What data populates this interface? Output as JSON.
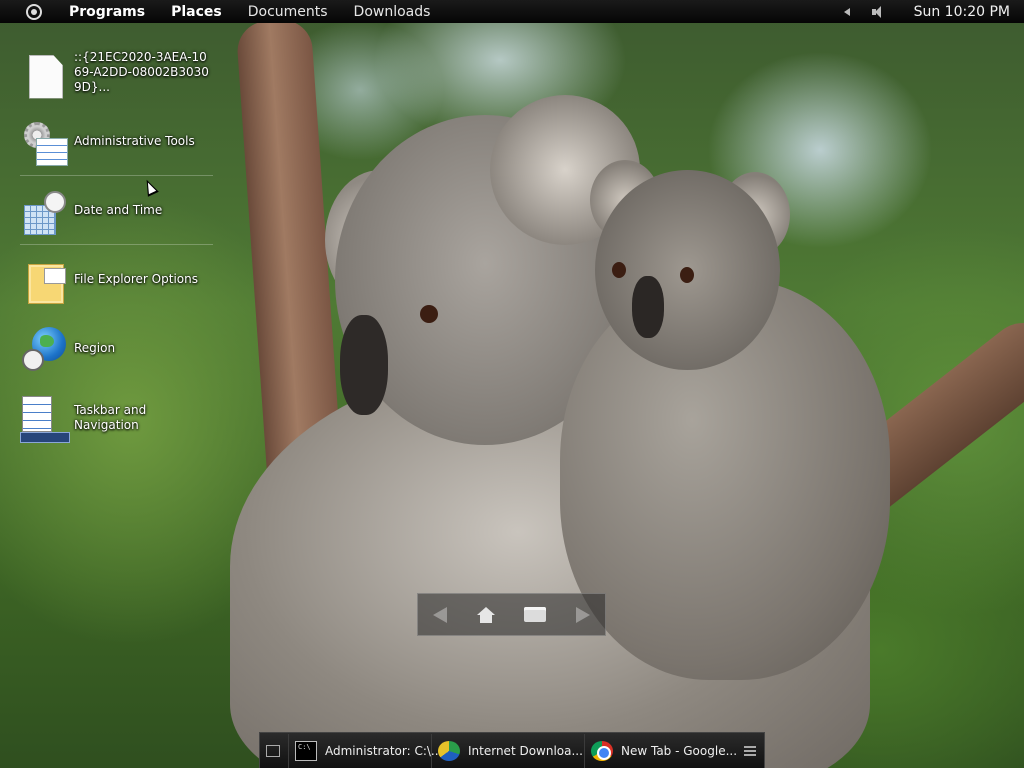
{
  "top_panel": {
    "menu": [
      "Programs",
      "Places",
      "Documents",
      "Downloads"
    ],
    "clock": "Sun 10:20 PM"
  },
  "desktop_icons": [
    {
      "label": "::{21EC2020-3AEA-1069-A2DD-08002B30309D}...",
      "icon": "document-icon"
    },
    {
      "label": "Administrative Tools",
      "icon": "admin-tools-icon"
    },
    {
      "label": "Date and Time",
      "icon": "date-time-icon"
    },
    {
      "label": "File Explorer Options",
      "icon": "folder-options-icon"
    },
    {
      "label": "Region",
      "icon": "globe-clock-icon"
    },
    {
      "label": "Taskbar and Navigation",
      "icon": "taskbar-icon"
    }
  ],
  "taskbar": {
    "tasks": [
      {
        "label": "Administrator: C:\\...",
        "icon": "cmd-icon"
      },
      {
        "label": "Internet Downloa...",
        "icon": "idm-icon"
      },
      {
        "label": "New Tab - Google...",
        "icon": "chrome-icon"
      }
    ]
  },
  "colors": {
    "panel": "#0a0a0a",
    "text": "#ffffff"
  }
}
